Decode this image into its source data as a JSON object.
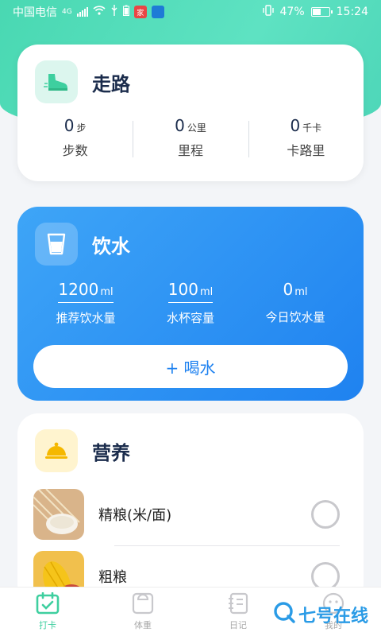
{
  "status_bar": {
    "carrier": "中国电信",
    "network": "4G",
    "battery": "47%",
    "time": "15:24"
  },
  "walk": {
    "title": "走路",
    "stats": [
      {
        "value": "0",
        "unit": "步",
        "label": "步数"
      },
      {
        "value": "0",
        "unit": "公里",
        "label": "里程"
      },
      {
        "value": "0",
        "unit": "千卡",
        "label": "卡路里"
      }
    ]
  },
  "water": {
    "title": "饮水",
    "stats": [
      {
        "value": "1200",
        "unit": "ml",
        "label": "推荐饮水量"
      },
      {
        "value": "100",
        "unit": "ml",
        "label": "水杯容量"
      },
      {
        "value": "0",
        "unit": "ml",
        "label": "今日饮水量"
      }
    ],
    "drink_button": "+ 喝水"
  },
  "nutrition": {
    "title": "营养",
    "items": [
      {
        "name": "精粮(米/面)"
      },
      {
        "name": "粗粮"
      }
    ]
  },
  "tabbar": {
    "tabs": [
      {
        "label": "打卡",
        "icon": "calendar-check-icon"
      },
      {
        "label": "体重",
        "icon": "scale-icon"
      },
      {
        "label": "日记",
        "icon": "notebook-icon"
      },
      {
        "label": "我的",
        "icon": "profile-icon"
      }
    ]
  },
  "watermark": "七号在线",
  "colors": {
    "accent_green": "#3ecf9f",
    "water_blue": "#1f82f0"
  }
}
